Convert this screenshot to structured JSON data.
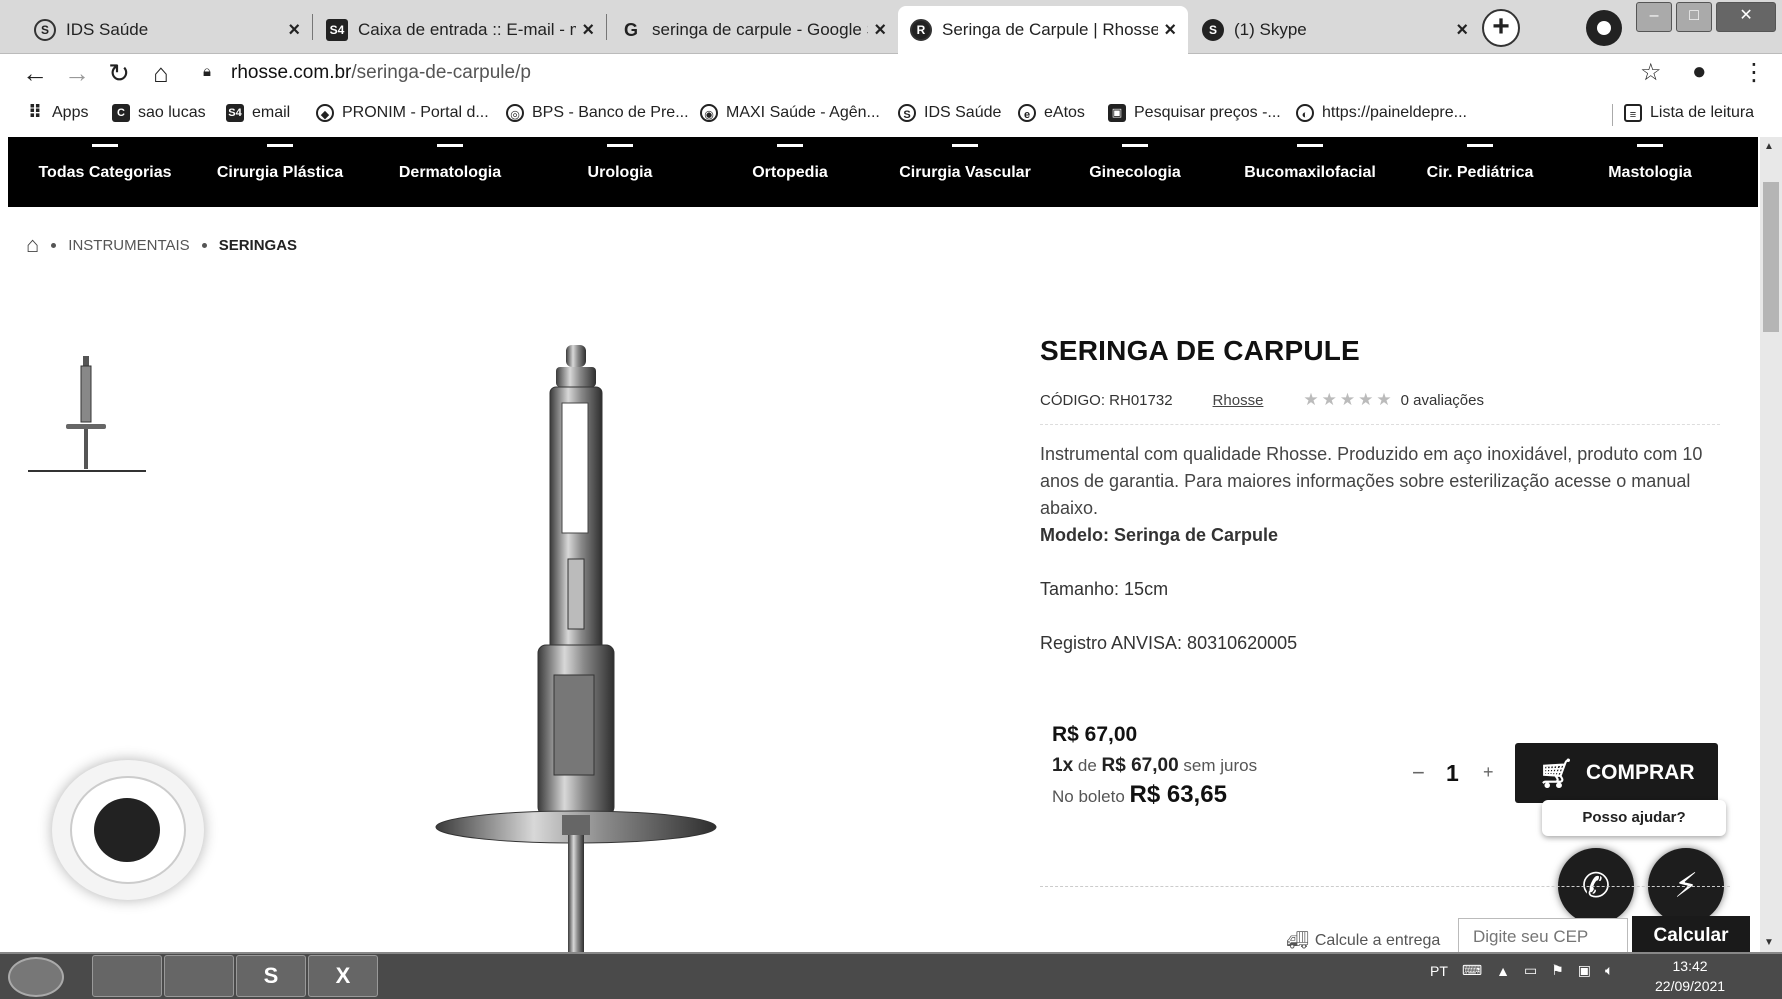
{
  "browser": {
    "tabs": [
      {
        "title": "IDS Saúde",
        "icon": "S"
      },
      {
        "title": "Caixa de entrada :: E-mail - m",
        "icon": "S4"
      },
      {
        "title": "seringa de carpule - Google Sh",
        "icon": "G"
      },
      {
        "title": "Seringa de Carpule | Rhosse I",
        "icon": "R",
        "active": true
      },
      {
        "title": "(1) Skype",
        "icon": "S"
      }
    ],
    "new_tab_label": "+",
    "url_host": "rhosse.com.br",
    "url_path": "/seringa-de-carpule/p",
    "bookmarks": [
      {
        "label": "Apps",
        "icon": "grid-icon"
      },
      {
        "label": "sao lucas",
        "icon": "C"
      },
      {
        "label": "email",
        "icon": "S4"
      },
      {
        "label": "PRONIM - Portal d...",
        "icon": "◆"
      },
      {
        "label": "BPS - Banco de Pre...",
        "icon": "◎"
      },
      {
        "label": "MAXI Saúde - Agên...",
        "icon": "◉"
      },
      {
        "label": "IDS Saúde",
        "icon": "S"
      },
      {
        "label": "eAtos",
        "icon": "e"
      },
      {
        "label": "Pesquisar preços -...",
        "icon": "▣"
      },
      {
        "label": "https://paineldepre...",
        "icon": "◐"
      }
    ],
    "reading_list": "Lista de leitura"
  },
  "categories": [
    "Todas Categorias",
    "Cirurgia Plástica",
    "Dermatologia",
    "Urologia",
    "Ortopedia",
    "Cirurgia Vascular",
    "Ginecologia",
    "Bucomaxilofacial",
    "Cir. Pediátrica",
    "Mastologia"
  ],
  "breadcrumb": {
    "level1": "INSTRUMENTAIS",
    "level2": "SERINGAS"
  },
  "product": {
    "title": "SERINGA DE CARPULE",
    "code": "CÓDIGO: RH01732",
    "brand": "Rhosse",
    "stars": "★★★★★",
    "reviews": "0 avaliações",
    "description": "Instrumental com qualidade Rhosse. Produzido em aço inoxidável, produto com 10 anos de garantia. Para maiores informações sobre esterilização acesse o manual abaixo.",
    "model": "Modelo: Seringa de Carpule",
    "size": "Tamanho: 15cm",
    "anvisa": "Registro ANVISA: 80310620005"
  },
  "pricing": {
    "price": "R$ 67,00",
    "inst_count": "1x",
    "inst_de": "de",
    "inst_value": "R$ 67,00",
    "inst_suffix": "sem juros",
    "boleto_label": "No boleto",
    "boleto_value": "R$ 63,65"
  },
  "purchase": {
    "qty_minus": "−",
    "qty": "1",
    "qty_plus": "+",
    "buy_label": "COMPRAR",
    "help": "Posso ajudar?"
  },
  "shipping": {
    "label": "Calcule a entrega",
    "placeholder": "Digite seu CEP",
    "button": "Calcular"
  },
  "taskbar": {
    "apps": [
      "",
      "",
      "S",
      "X"
    ],
    "lang": "PT",
    "time": "13:42",
    "date": "22/09/2021"
  }
}
